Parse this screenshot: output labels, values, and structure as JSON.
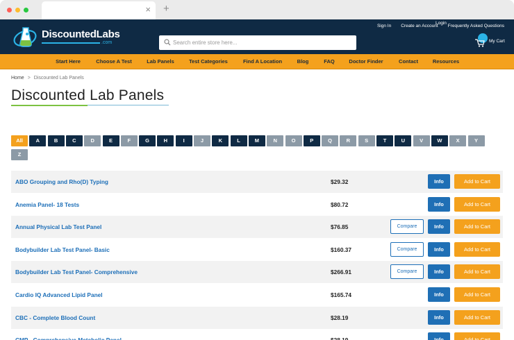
{
  "browser": {
    "traffic_lights": [
      "#ff5f57",
      "#febc2e",
      "#28c840"
    ],
    "tab_close_icon": "×",
    "new_tab_icon": "+"
  },
  "header": {
    "logo": {
      "name": "DiscountedLabs",
      "sub": ".com"
    },
    "search": {
      "placeholder": "Search entire store here..."
    },
    "top_links": [
      "Sign In",
      "Create an Account",
      "Frequently Asked Questions"
    ],
    "login_label": "Login",
    "cart_label": "My Cart"
  },
  "nav": {
    "items": [
      "Start Here",
      "Choose A Test",
      "Lab Panels",
      "Test Categories",
      "Find A Location",
      "Blog",
      "FAQ",
      "Doctor Finder",
      "Contact",
      "Resources"
    ]
  },
  "breadcrumb": {
    "home": "Home",
    "separator": ">",
    "current": "Discounted Lab Panels"
  },
  "page_title": "Discounted Lab Panels",
  "letters": [
    {
      "label": "All",
      "state": "all"
    },
    {
      "label": "A",
      "state": "active"
    },
    {
      "label": "B",
      "state": "active"
    },
    {
      "label": "C",
      "state": "active"
    },
    {
      "label": "D",
      "state": "inactive"
    },
    {
      "label": "E",
      "state": "active"
    },
    {
      "label": "F",
      "state": "inactive"
    },
    {
      "label": "G",
      "state": "active"
    },
    {
      "label": "H",
      "state": "active"
    },
    {
      "label": "I",
      "state": "active"
    },
    {
      "label": "J",
      "state": "inactive"
    },
    {
      "label": "K",
      "state": "active"
    },
    {
      "label": "L",
      "state": "active"
    },
    {
      "label": "M",
      "state": "active"
    },
    {
      "label": "N",
      "state": "inactive"
    },
    {
      "label": "O",
      "state": "inactive"
    },
    {
      "label": "P",
      "state": "active"
    },
    {
      "label": "Q",
      "state": "inactive"
    },
    {
      "label": "R",
      "state": "inactive"
    },
    {
      "label": "S",
      "state": "inactive"
    },
    {
      "label": "T",
      "state": "active"
    },
    {
      "label": "U",
      "state": "active"
    },
    {
      "label": "V",
      "state": "inactive"
    },
    {
      "label": "W",
      "state": "active"
    },
    {
      "label": "X",
      "state": "inactive"
    },
    {
      "label": "Y",
      "state": "inactive"
    },
    {
      "label": "Z",
      "state": "inactive"
    }
  ],
  "buttons": {
    "compare": "Compare",
    "info": "Info",
    "add_to_cart": "Add to Cart"
  },
  "panels": [
    {
      "name": "ABO Grouping and Rho(D) Typing",
      "price": "$29.32",
      "compare": false
    },
    {
      "name": "Anemia Panel- 18 Tests",
      "price": "$80.72",
      "compare": false
    },
    {
      "name": "Annual Physical Lab Test Panel",
      "price": "$76.85",
      "compare": true
    },
    {
      "name": "Bodybuilder Lab Test Panel- Basic",
      "price": "$160.37",
      "compare": true
    },
    {
      "name": "Bodybuilder Lab Test Panel- Comprehensive",
      "price": "$266.91",
      "compare": true
    },
    {
      "name": "Cardio IQ Advanced Lipid Panel",
      "price": "$165.74",
      "compare": false
    },
    {
      "name": "CBC - Complete Blood Count",
      "price": "$28.19",
      "compare": false
    },
    {
      "name": "CMP - Comprehensive Metabolic Panel",
      "price": "$28.19",
      "compare": false
    }
  ]
}
